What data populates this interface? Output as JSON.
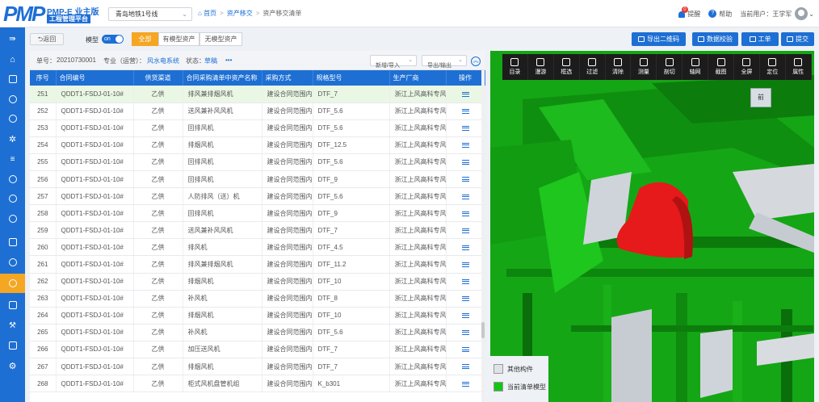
{
  "app": {
    "logo": "PMP",
    "logo_sub1": "PMP-E 业主版",
    "logo_sub2": "工程管理平台"
  },
  "header": {
    "project": "青岛地铁1号线",
    "breadcrumb": [
      "首页",
      "资产移交",
      "资产移交清单"
    ],
    "remind_label": "提醒",
    "remind_count": "0",
    "help_label": "帮助",
    "user_label": "当前用户：王学军"
  },
  "sidebar": {
    "items": [
      "expand-icon",
      "home-icon",
      "grid-icon",
      "flow-icon",
      "camera-icon",
      "gear-icon",
      "sliders-icon",
      "clock-icon",
      "check-icon",
      "person-icon",
      "doc-icon",
      "compass-icon",
      "asset-icon",
      "chart-icon",
      "hammer-icon",
      "card-icon",
      "settings-icon"
    ],
    "active_index": 13,
    "accent": "#f5a623"
  },
  "toolbar": {
    "back": "返回",
    "model_label": "模型",
    "model_toggle": "on",
    "tabs": [
      "全部",
      "有模型资产",
      "无模型资产"
    ],
    "active_tab": 0,
    "actions": [
      "导出二维码",
      "数据校验",
      "工单",
      "提交"
    ]
  },
  "info": {
    "order_no_label": "单号：",
    "order_no": "20210730001",
    "major_label": "专业（运营）：",
    "major": "风水电系统",
    "status_label": "状态：",
    "status": "草稿",
    "more": "•••",
    "import_btn": "新增/导入",
    "export_btn": "导出/输出"
  },
  "table": {
    "headers": [
      "序号",
      "合同编号",
      "供货渠道",
      "合同采购清单中资产名称",
      "采购方式",
      "规格型号",
      "生产厂商",
      "操作"
    ],
    "rows": [
      [
        "251",
        "QDDT1-FSDJ-01-10#",
        "乙供",
        "排风兼排烟风机",
        "建设合同范围内",
        "DTF_7",
        "浙江上风高科专风实"
      ],
      [
        "252",
        "QDDT1-FSDJ-01-10#",
        "乙供",
        "送风兼补风风机",
        "建设合同范围内",
        "DTF_5.6",
        "浙江上风高科专风实"
      ],
      [
        "253",
        "QDDT1-FSDJ-01-10#",
        "乙供",
        "回排风机",
        "建设合同范围内",
        "DTF_5.6",
        "浙江上风高科专风实"
      ],
      [
        "254",
        "QDDT1-FSDJ-01-10#",
        "乙供",
        "排烟风机",
        "建设合同范围内",
        "DTF_12.5",
        "浙江上风高科专风实"
      ],
      [
        "255",
        "QDDT1-FSDJ-01-10#",
        "乙供",
        "回排风机",
        "建设合同范围内",
        "DTF_5.6",
        "浙江上风高科专风实"
      ],
      [
        "256",
        "QDDT1-FSDJ-01-10#",
        "乙供",
        "回排风机",
        "建设合同范围内",
        "DTF_9",
        "浙江上风高科专风实"
      ],
      [
        "257",
        "QDDT1-FSDJ-01-10#",
        "乙供",
        "人防排风（送）机",
        "建设合同范围内",
        "DTF_5.6",
        "浙江上风高科专风实"
      ],
      [
        "258",
        "QDDT1-FSDJ-01-10#",
        "乙供",
        "回排风机",
        "建设合同范围内",
        "DTF_9",
        "浙江上风高科专风实"
      ],
      [
        "259",
        "QDDT1-FSDJ-01-10#",
        "乙供",
        "送风兼补风风机",
        "建设合同范围内",
        "DTF_7",
        "浙江上风高科专风实"
      ],
      [
        "260",
        "QDDT1-FSDJ-01-10#",
        "乙供",
        "排风机",
        "建设合同范围内",
        "DTF_4.5",
        "浙江上风高科专风实"
      ],
      [
        "261",
        "QDDT1-FSDJ-01-10#",
        "乙供",
        "排风兼排烟风机",
        "建设合同范围内",
        "DTF_11.2",
        "浙江上风高科专风实"
      ],
      [
        "262",
        "QDDT1-FSDJ-01-10#",
        "乙供",
        "排烟风机",
        "建设合同范围内",
        "DTF_10",
        "浙江上风高科专风实"
      ],
      [
        "263",
        "QDDT1-FSDJ-01-10#",
        "乙供",
        "补风机",
        "建设合同范围内",
        "DTF_8",
        "浙江上风高科专风实"
      ],
      [
        "264",
        "QDDT1-FSDJ-01-10#",
        "乙供",
        "排烟风机",
        "建设合同范围内",
        "DTF_10",
        "浙江上风高科专风实"
      ],
      [
        "265",
        "QDDT1-FSDJ-01-10#",
        "乙供",
        "补风机",
        "建设合同范围内",
        "DTF_5.6",
        "浙江上风高科专风实"
      ],
      [
        "266",
        "QDDT1-FSDJ-01-10#",
        "乙供",
        "加压送风机",
        "建设合同范围内",
        "DTF_7",
        "浙江上风高科专风实"
      ],
      [
        "267",
        "QDDT1-FSDJ-01-10#",
        "乙供",
        "排烟风机",
        "建设合同范围内",
        "DTF_7",
        "浙江上风高科专风实"
      ],
      [
        "268",
        "QDDT1-FSDJ-01-10#",
        "乙供",
        "柜式风机盘管机组",
        "建设合同范围内",
        "K_b301",
        "浙江上风高科专风实"
      ]
    ],
    "selected_index": 0
  },
  "viewer": {
    "tools": [
      "目录",
      "漫游",
      "框选",
      "过滤",
      "清除",
      "测量",
      "剖切",
      "轴网",
      "截图",
      "全屏",
      "定位",
      "属性"
    ],
    "cube_label": "前",
    "legend": [
      {
        "label": "其他构件",
        "color": "#dfe3e8"
      },
      {
        "label": "当前清单模型",
        "color": "#15c515"
      }
    ],
    "model_color": "#15a615",
    "highlight_color": "#e61a1a"
  }
}
